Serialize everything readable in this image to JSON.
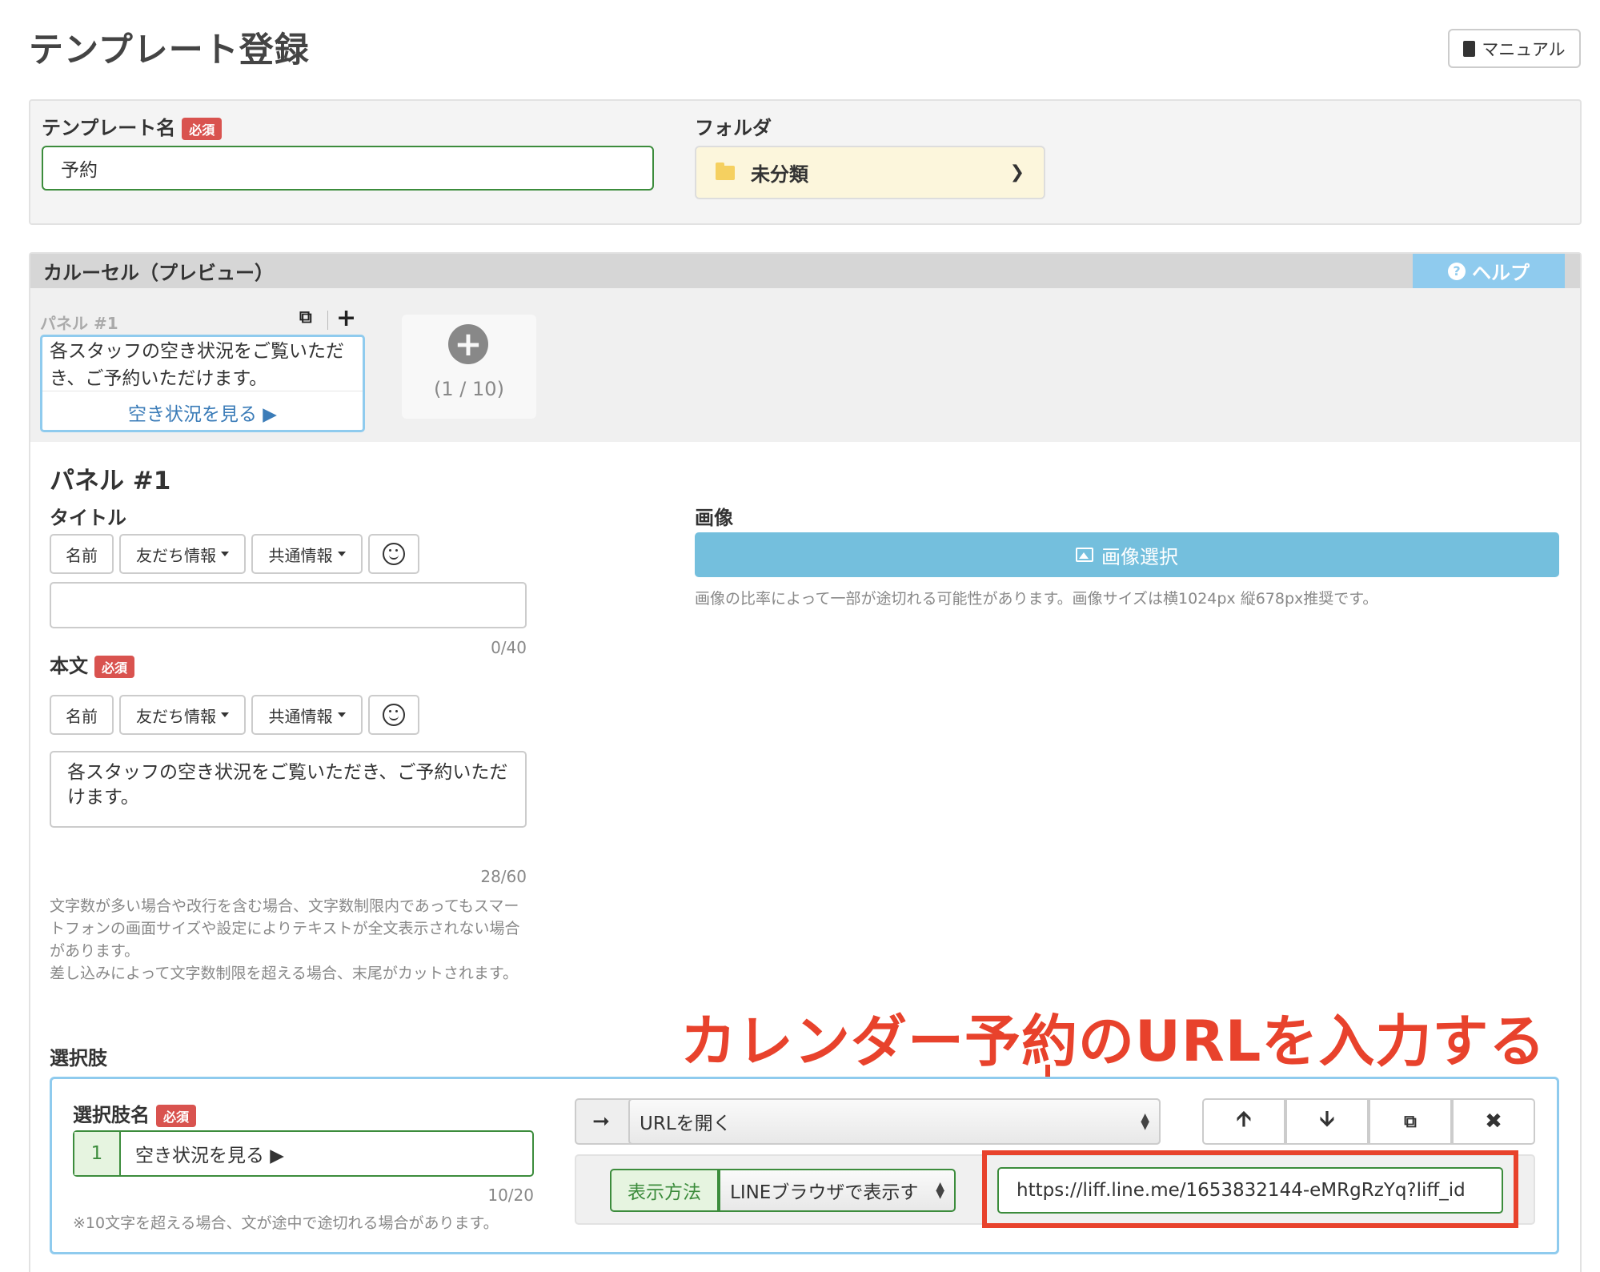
{
  "header": {
    "title": "テンプレート登録",
    "manual_label": "マニュアル"
  },
  "template_form": {
    "name_label": "テンプレート名",
    "required": "必須",
    "name_value": "予約",
    "folder_label": "フォルダ",
    "folder_value": "未分類"
  },
  "carousel": {
    "title": "カルーセル（プレビュー）",
    "help_label": "ヘルプ",
    "panel_label": "パネル #1",
    "card_text": "各スタッフの空き状況をご覧いただき、ご予約いただけます。",
    "card_link": "空き状況を見る ▶",
    "add_count": "(1 / 10)"
  },
  "panel": {
    "heading": "パネル #1",
    "title_label": "タイトル",
    "tag_name": "名前",
    "tag_friend": "友だち情報",
    "tag_common": "共通情報",
    "title_counter": "0/40",
    "body_label": "本文",
    "body_value": "各スタッフの空き状況をご覧いただき、ご予約いただけます。",
    "body_counter": "28/60",
    "note": "文字数が多い場合や改行を含む場合、文字数制限内であってもスマートフォンの画面サイズや設定によりテキストが全文表示されない場合があります。\n差し込みによって文字数制限を超える場合、末尾がカットされます。",
    "image_label": "画像",
    "image_button": "画像選択",
    "image_note": "画像の比率によって一部が途切れる可能性があります。画像サイズは横1024px 縦678px推奨です。"
  },
  "choices": {
    "label": "選択肢",
    "name_label": "選択肢名",
    "index": "1",
    "name_value": "空き状況を見る ▶",
    "counter": "10/20",
    "note": "※10文字を超える場合、文が途中で途切れる場合があります。",
    "action_value": "URLを開く",
    "display_label": "表示方法",
    "display_value": "LINEブラウザで表示す",
    "url_value": "https://liff.line.me/1653832144-eMRgRzYq?liff_id"
  },
  "annotation": {
    "text": "カレンダー予約のURLを入力する",
    "color": "#e8422c"
  },
  "colors": {
    "accent_green": "#3c8c3c",
    "accent_blue": "#8fcbee",
    "required_red": "#d9534f"
  }
}
